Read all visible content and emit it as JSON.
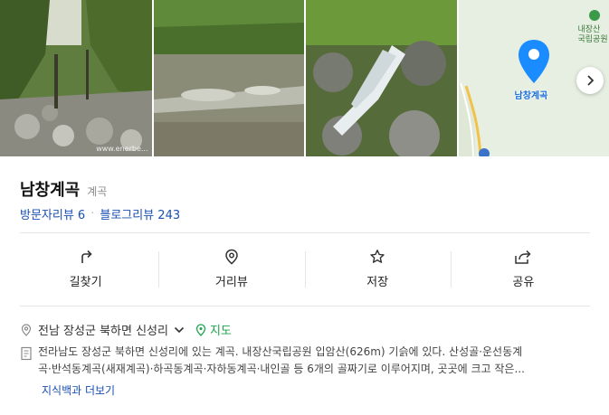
{
  "gallery": {
    "watermark": "www.enerbe...",
    "map": {
      "park_label": "내장산\n국립공원",
      "pin_label": "남창계곡"
    }
  },
  "place": {
    "title": "남창계곡",
    "category": "계곡",
    "visitor_reviews_label": "방문자리뷰 6",
    "blog_reviews_label": "블로그리뷰 243"
  },
  "actions": [
    {
      "label": "길찾기",
      "icon": "directions-icon"
    },
    {
      "label": "거리뷰",
      "icon": "street-view-icon"
    },
    {
      "label": "저장",
      "icon": "star-icon"
    },
    {
      "label": "공유",
      "icon": "share-icon"
    }
  ],
  "info": {
    "address": "전남 장성군 북하면 신성리",
    "map_link": "지도",
    "description_line1": "전라남도 장성군 북하면 신성리에 있는 계곡. 내장산국립공원 입암산(626m) 기슭에 있다. 산성골·운선동계",
    "description_line2": "곡·반석동계곡(새재계곡)·하곡동계곡·자하동계곡·내인골 등 6개의 골짜기로 이루어지며, 곳곳에 크고 작은...",
    "more_link": "지식백과 더보기"
  },
  "colors": {
    "link": "#1a4fb3",
    "map_green": "#1aa34a",
    "pin": "#1a8cff"
  }
}
